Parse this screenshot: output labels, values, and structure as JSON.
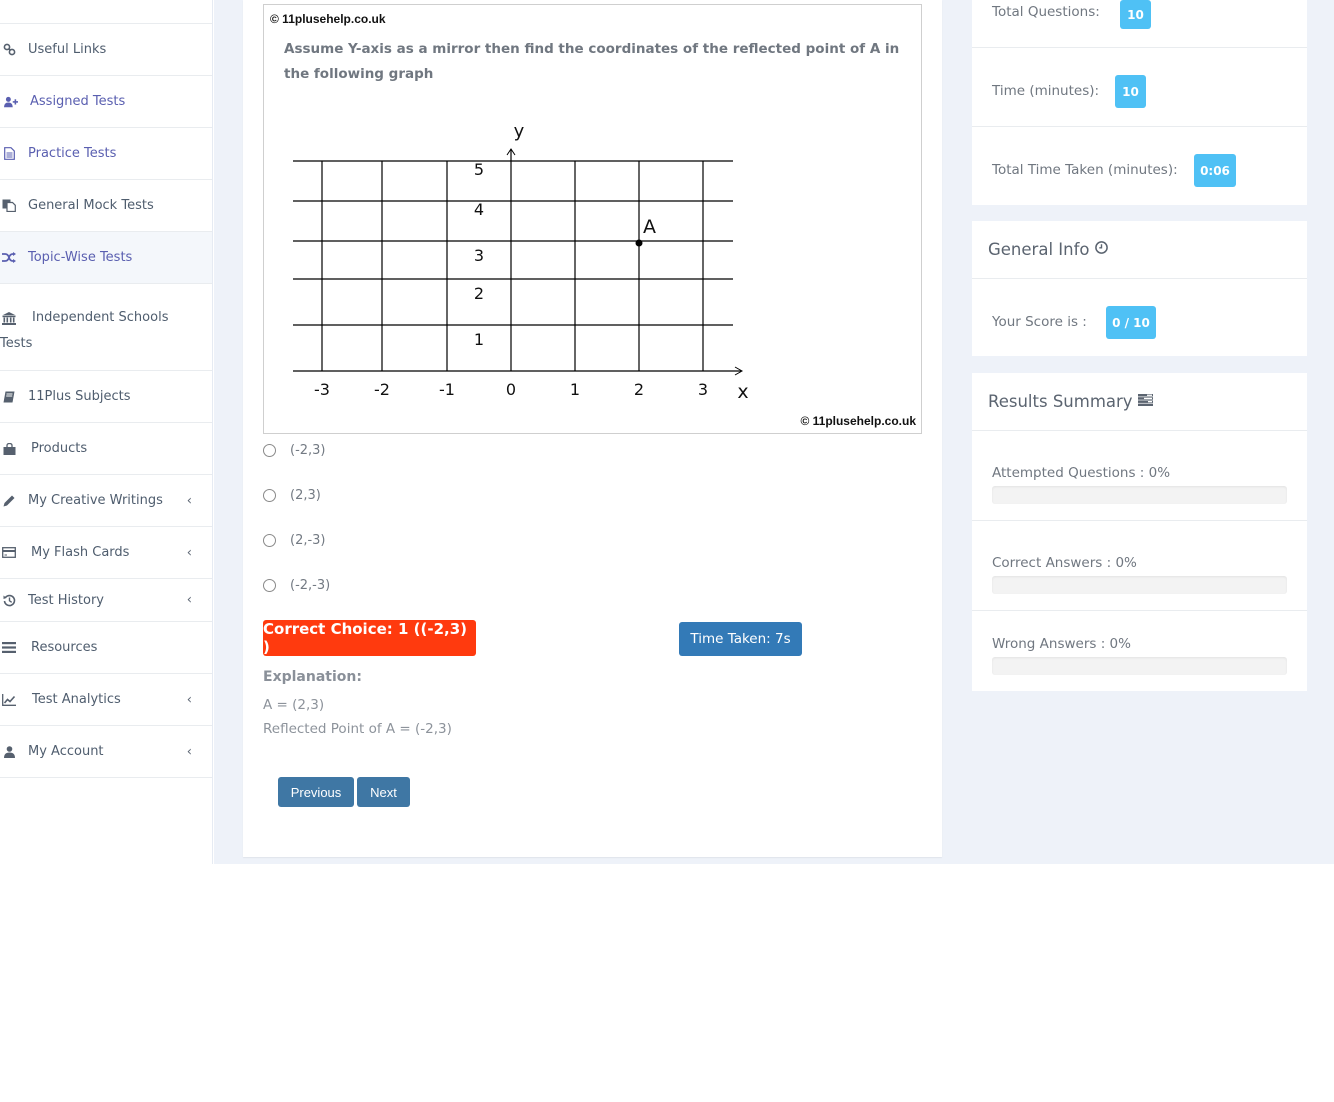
{
  "sidebar": {
    "items": [
      {
        "label": "Useful Links",
        "icon": "link-icon",
        "active": false,
        "purple": false,
        "submenu": false
      },
      {
        "label": "Assigned Tests",
        "icon": "user-plus-icon",
        "active": false,
        "purple": true,
        "submenu": false
      },
      {
        "label": "Practice Tests",
        "icon": "file-text-icon",
        "active": false,
        "purple": true,
        "submenu": false
      },
      {
        "label": "General Mock Tests",
        "icon": "copy-icon",
        "active": false,
        "purple": false,
        "submenu": false
      },
      {
        "label": "Topic-Wise Tests",
        "icon": "shuffle-icon",
        "active": true,
        "purple": true,
        "submenu": false
      },
      {
        "label": "Independent Schools",
        "label_line2": "Tests",
        "icon": "bank-icon",
        "active": false,
        "purple": false,
        "submenu": false
      },
      {
        "label": "11Plus Subjects",
        "icon": "book-icon",
        "active": false,
        "purple": false,
        "submenu": false
      },
      {
        "label": "Products",
        "icon": "shopping-bag-icon",
        "active": false,
        "purple": false,
        "submenu": false
      },
      {
        "label": "My Creative Writings",
        "icon": "pencil-icon",
        "active": false,
        "purple": false,
        "submenu": true
      },
      {
        "label": "My Flash Cards",
        "icon": "credit-card-icon",
        "active": false,
        "purple": false,
        "submenu": true
      },
      {
        "label": "Test History",
        "icon": "history-icon",
        "active": false,
        "purple": false,
        "submenu": true
      },
      {
        "label": "Resources",
        "icon": "list-icon",
        "active": false,
        "purple": false,
        "submenu": false
      },
      {
        "label": "Test Analytics",
        "icon": "line-chart-icon",
        "active": false,
        "purple": false,
        "submenu": true
      },
      {
        "label": "My Account",
        "icon": "user-icon",
        "active": false,
        "purple": false,
        "submenu": true
      }
    ],
    "chevron_glyph": "‹"
  },
  "question": {
    "copyright_top": "© 11plusehelp.co.uk",
    "copyright_bottom": "© 11plusehelp.co.uk",
    "text": "Assume Y-axis as a mirror then find the coordinates of the reflected point of A in the following graph",
    "options": [
      "(-2,3)",
      "(2,3)",
      "(2,-3)",
      "(-2,-3)"
    ],
    "correct_choice": "Correct Choice: 1 ((-2,3) )",
    "time_taken": "Time Taken: 7s",
    "explanation_title": "Explanation:",
    "explanation_lines": [
      "A = (2,3)",
      "Reflected Point of A = (-2,3)"
    ],
    "prev_label": "Previous",
    "next_label": "Next"
  },
  "chart_data": {
    "type": "scatter",
    "title": "",
    "xlabel": "x",
    "ylabel": "y",
    "x_ticks": [
      -3,
      -2,
      -1,
      0,
      1,
      2,
      3
    ],
    "y_ticks": [
      1,
      2,
      3,
      4,
      5
    ],
    "xlim": [
      -3.5,
      3.5
    ],
    "ylim": [
      0,
      5
    ],
    "grid": true,
    "points": [
      {
        "label": "A",
        "x": 2,
        "y": 3
      }
    ]
  },
  "stats": {
    "total_questions_label": "Total Questions:",
    "total_questions": "10",
    "time_label": "Time (minutes):",
    "time": "10",
    "total_time_label": "Total Time Taken (minutes):",
    "total_time": "0:06"
  },
  "general_info": {
    "title": "General Info",
    "icon": "clock-icon",
    "score_label": "Your Score is :",
    "score": "0 / 10"
  },
  "results_summary": {
    "title": "Results Summary",
    "icon": "tasks-icon",
    "items": [
      {
        "label": "Attempted Questions : 0%",
        "percent": 0
      },
      {
        "label": "Correct Answers : 0%",
        "percent": 0
      },
      {
        "label": "Wrong Answers : 0%",
        "percent": 0
      }
    ]
  },
  "colors": {
    "correct": "#ff3a0e",
    "primary": "#337ab7",
    "nav_button": "#3f77a4",
    "badge": "#4fc1f5",
    "accent_purple": "#5a5fb0"
  }
}
